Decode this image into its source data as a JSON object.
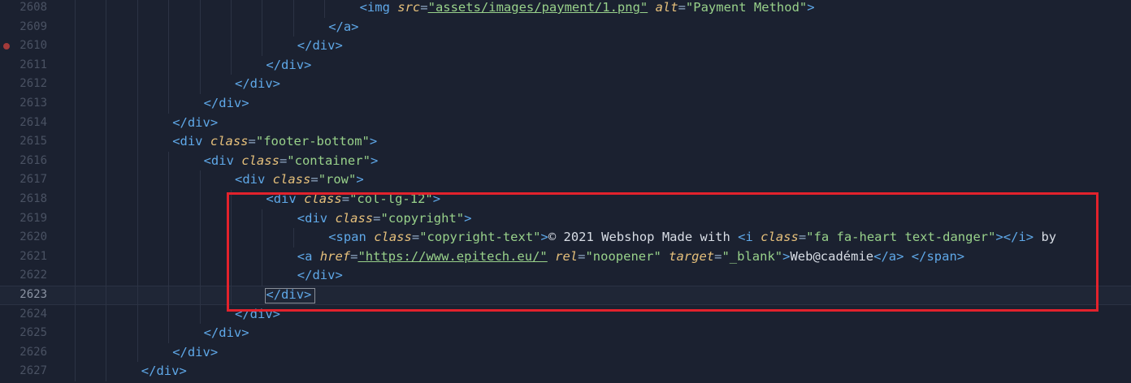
{
  "editor": {
    "lines": [
      {
        "num": "2608",
        "indent": 9,
        "tokens": [
          {
            "t": "tag",
            "v": "<img "
          },
          {
            "t": "attr",
            "v": "src"
          },
          {
            "t": "eq",
            "v": "="
          },
          {
            "t": "url",
            "v": "\"assets/images/payment/1.png\""
          },
          {
            "t": "text",
            "v": " "
          },
          {
            "t": "attr",
            "v": "alt"
          },
          {
            "t": "eq",
            "v": "="
          },
          {
            "t": "str",
            "v": "\"Payment Method\""
          },
          {
            "t": "tag",
            "v": ">"
          }
        ]
      },
      {
        "num": "2609",
        "indent": 8,
        "tokens": [
          {
            "t": "tag",
            "v": "</a>"
          }
        ]
      },
      {
        "num": "2610",
        "indent": 7,
        "breakpoint": true,
        "tokens": [
          {
            "t": "tag",
            "v": "</div>"
          }
        ]
      },
      {
        "num": "2611",
        "indent": 6,
        "tokens": [
          {
            "t": "tag",
            "v": "</div>"
          }
        ]
      },
      {
        "num": "2612",
        "indent": 5,
        "tokens": [
          {
            "t": "tag",
            "v": "</div>"
          }
        ]
      },
      {
        "num": "2613",
        "indent": 4,
        "tokens": [
          {
            "t": "tag",
            "v": "</div>"
          }
        ]
      },
      {
        "num": "2614",
        "indent": 3,
        "tokens": [
          {
            "t": "tag",
            "v": "</div>"
          }
        ]
      },
      {
        "num": "2615",
        "indent": 3,
        "tokens": [
          {
            "t": "tag",
            "v": "<div "
          },
          {
            "t": "attr",
            "v": "class"
          },
          {
            "t": "eq",
            "v": "="
          },
          {
            "t": "str",
            "v": "\"footer-bottom\""
          },
          {
            "t": "tag",
            "v": ">"
          }
        ]
      },
      {
        "num": "2616",
        "indent": 4,
        "tokens": [
          {
            "t": "tag",
            "v": "<div "
          },
          {
            "t": "attr",
            "v": "class"
          },
          {
            "t": "eq",
            "v": "="
          },
          {
            "t": "str",
            "v": "\"container\""
          },
          {
            "t": "tag",
            "v": ">"
          }
        ]
      },
      {
        "num": "2617",
        "indent": 5,
        "tokens": [
          {
            "t": "tag",
            "v": "<div "
          },
          {
            "t": "attr",
            "v": "class"
          },
          {
            "t": "eq",
            "v": "="
          },
          {
            "t": "str",
            "v": "\"row\""
          },
          {
            "t": "tag",
            "v": ">"
          }
        ]
      },
      {
        "num": "2618",
        "indent": 6,
        "tokens": [
          {
            "t": "tag",
            "v": "<div "
          },
          {
            "t": "attr",
            "v": "class"
          },
          {
            "t": "eq",
            "v": "="
          },
          {
            "t": "str",
            "v": "\"col-lg-12\""
          },
          {
            "t": "tag",
            "v": ">"
          }
        ]
      },
      {
        "num": "2619",
        "indent": 7,
        "tokens": [
          {
            "t": "tag",
            "v": "<div "
          },
          {
            "t": "attr",
            "v": "class"
          },
          {
            "t": "eq",
            "v": "="
          },
          {
            "t": "str",
            "v": "\"copyright\""
          },
          {
            "t": "tag",
            "v": ">"
          }
        ]
      },
      {
        "num": "2620",
        "indent": 8,
        "tokens": [
          {
            "t": "tag",
            "v": "<span "
          },
          {
            "t": "attr",
            "v": "class"
          },
          {
            "t": "eq",
            "v": "="
          },
          {
            "t": "str",
            "v": "\"copyright-text\""
          },
          {
            "t": "tag",
            "v": ">"
          },
          {
            "t": "text",
            "v": "© 2021 Webshop Made with "
          },
          {
            "t": "tag",
            "v": "<i "
          },
          {
            "t": "attr",
            "v": "class"
          },
          {
            "t": "eq",
            "v": "="
          },
          {
            "t": "str",
            "v": "\"fa fa-heart text-danger\""
          },
          {
            "t": "tag",
            "v": "></i>"
          },
          {
            "t": "text",
            "v": " by"
          }
        ]
      },
      {
        "num": "2621",
        "indent": 7,
        "tokens": [
          {
            "t": "tag",
            "v": "<a "
          },
          {
            "t": "attr",
            "v": "href"
          },
          {
            "t": "eq",
            "v": "="
          },
          {
            "t": "url",
            "v": "\"https://www.epitech.eu/\""
          },
          {
            "t": "text",
            "v": " "
          },
          {
            "t": "attr",
            "v": "rel"
          },
          {
            "t": "eq",
            "v": "="
          },
          {
            "t": "str",
            "v": "\"noopener\""
          },
          {
            "t": "text",
            "v": " "
          },
          {
            "t": "attr",
            "v": "target"
          },
          {
            "t": "eq",
            "v": "="
          },
          {
            "t": "str",
            "v": "\"_blank\""
          },
          {
            "t": "tag",
            "v": ">"
          },
          {
            "t": "text",
            "v": "Web@cadémie"
          },
          {
            "t": "tag",
            "v": "</a>"
          },
          {
            "t": "text",
            "v": " "
          },
          {
            "t": "tag",
            "v": "</span>"
          }
        ]
      },
      {
        "num": "2622",
        "indent": 7,
        "tokens": [
          {
            "t": "tag",
            "v": "</div>"
          }
        ]
      },
      {
        "num": "2623",
        "indent": 6,
        "current": true,
        "tokens": [
          {
            "t": "tag",
            "v": "</div>"
          }
        ]
      },
      {
        "num": "2624",
        "indent": 5,
        "tokens": [
          {
            "t": "tag",
            "v": "</div>"
          }
        ]
      },
      {
        "num": "2625",
        "indent": 4,
        "tokens": [
          {
            "t": "tag",
            "v": "</div>"
          }
        ]
      },
      {
        "num": "2626",
        "indent": 3,
        "tokens": [
          {
            "t": "tag",
            "v": "</div>"
          }
        ]
      },
      {
        "num": "2627",
        "indent": 2,
        "tokens": [
          {
            "t": "tag",
            "v": "</div>"
          }
        ]
      }
    ]
  },
  "colors": {
    "background": "#1b2130",
    "tag": "#5fa8e8",
    "attribute": "#e6c07b",
    "string": "#98d18a",
    "highlight_box": "#e3222c",
    "breakpoint": "#a33a3a"
  }
}
